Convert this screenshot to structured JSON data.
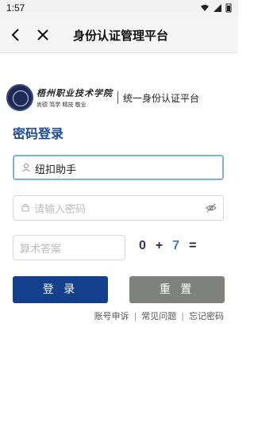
{
  "status_bar": {
    "time": "1:57"
  },
  "app_bar": {
    "title": "身份认证管理平台"
  },
  "logo": {
    "school_name": "梧州职业技术学院",
    "motto": "尚德 笃学 精技 敬业",
    "platform_name": "统一身份认证平台"
  },
  "login": {
    "section_title": "密码登录",
    "username_value": "纽扣助手",
    "password_placeholder": "请输入密码",
    "captcha_placeholder": "算术答案",
    "captcha": {
      "a": "0",
      "op": "+",
      "b": "7",
      "eq": "="
    },
    "login_label": "登 录",
    "reset_label": "重 置"
  },
  "links": {
    "appeal": "账号申诉",
    "faq": "常见问题",
    "forgot": "忘记密码"
  },
  "colors": {
    "primary": "#143f8c",
    "title_blue": "#1e4a9a",
    "reset_gray": "#7e817e",
    "captcha_digit_dark": "#3b2a6b",
    "captcha_op": "#2b2b2b",
    "captcha_digit_blue": "#3f78c6",
    "captcha_eq": "#1e1e1e"
  }
}
